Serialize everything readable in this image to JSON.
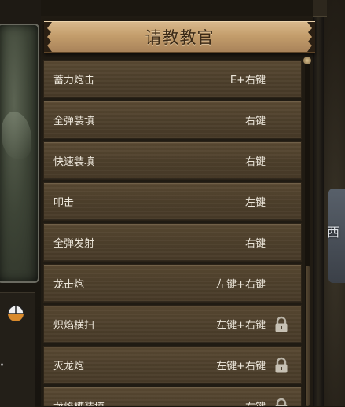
{
  "panel": {
    "title": "请教教官"
  },
  "skills": [
    {
      "name": "蓄力炮击",
      "key": "E+右键",
      "locked": false
    },
    {
      "name": "全弹装填",
      "key": "右键",
      "locked": false
    },
    {
      "name": "快速装填",
      "key": "右键",
      "locked": false
    },
    {
      "name": "叩击",
      "key": "左键",
      "locked": false
    },
    {
      "name": "全弹发射",
      "key": "右键",
      "locked": false
    },
    {
      "name": "龙击炮",
      "key": "左键+右键",
      "locked": false
    },
    {
      "name": "炽焰横扫",
      "key": "左键+右键",
      "locked": true
    },
    {
      "name": "灭龙炮",
      "key": "左键+右键",
      "locked": true
    },
    {
      "name": "龙焰槽装填",
      "key": "右键",
      "locked": true
    }
  ],
  "scenery": {
    "text": "西"
  },
  "left": {
    "dot": "°"
  },
  "colors": {
    "banner": "#c49e6c",
    "row": "#4e402c",
    "text": "#ece6da",
    "title_text": "#3b2a17"
  },
  "icons": {
    "lock": "lock-icon",
    "weapon": "weapon-type-icon"
  }
}
